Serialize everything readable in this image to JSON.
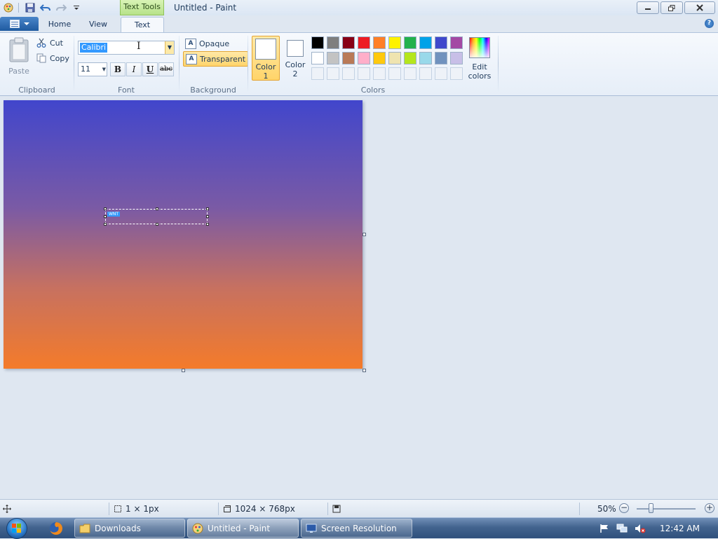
{
  "titlebar": {
    "contextual_tab": "Text Tools",
    "title": "Untitled - Paint"
  },
  "tabs": {
    "home": "Home",
    "view": "View",
    "text": "Text"
  },
  "clipboard": {
    "paste": "Paste",
    "cut": "Cut",
    "copy": "Copy",
    "group_label": "Clipboard"
  },
  "font": {
    "family": "Calibri",
    "size": "11",
    "bold": "B",
    "italic": "I",
    "underline": "U",
    "strikethrough": "abc",
    "group_label": "Font"
  },
  "background": {
    "opaque": "Opaque",
    "transparent": "Transparent",
    "group_label": "Background"
  },
  "colors": {
    "color1_line1": "Color",
    "color1_line2": "1",
    "color2_line1": "Color",
    "color2_line2": "2",
    "edit_line1": "Edit",
    "edit_line2": "colors",
    "group_label": "Colors",
    "palette_row1": [
      "#000000",
      "#7f7f7f",
      "#880015",
      "#ed1c24",
      "#ff7f27",
      "#fff200",
      "#22b14c",
      "#00a2e8",
      "#3f48cc",
      "#a349a4"
    ],
    "palette_row2": [
      "#ffffff",
      "#c3c3c3",
      "#b97a57",
      "#ffaec9",
      "#ffc90e",
      "#efe4b0",
      "#b5e61d",
      "#99d9ea",
      "#7092be",
      "#c8bfe7"
    ]
  },
  "canvas": {
    "gradient_top": "#4146cc",
    "gradient_bottom": "#f47b2a",
    "text_selection": "WNT"
  },
  "statusbar": {
    "selection_size": "1 × 1px",
    "image_size": "1024 × 768px",
    "zoom": "50%"
  },
  "taskbar": {
    "items": [
      {
        "label": "Downloads"
      },
      {
        "label": "Untitled - Paint"
      },
      {
        "label": "Screen Resolution"
      }
    ],
    "clock": "12:42 AM"
  }
}
